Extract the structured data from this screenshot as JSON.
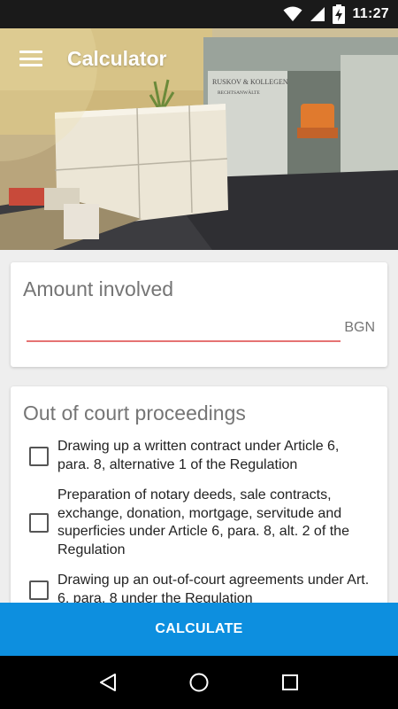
{
  "status_bar": {
    "time": "11:27",
    "icons": [
      "wifi-icon",
      "signal-icon",
      "battery-charging-icon"
    ]
  },
  "toolbar": {
    "title": "Calculator",
    "menu_icon": "hamburger-menu-icon"
  },
  "hero": {
    "sign_line1": "RUSKOV & KOLLEGEN",
    "sign_line2": "RECHTSANWÄLTE"
  },
  "amount": {
    "label": "Amount involved",
    "value": "",
    "currency": "BGN"
  },
  "proceedings": {
    "title": "Out of court proceedings",
    "options": [
      {
        "label": "Drawing up a written contract under Article 6, para. 8, alternative 1 of the Regulation",
        "checked": false
      },
      {
        "label": "Preparation of notary deeds, sale contracts, exchange, donation, mortgage, servitude and superficies under Article 6, para. 8, alt. 2 of the Regulation",
        "checked": false
      },
      {
        "label": "Drawing up an out-of-court agreements under Art. 6, para. 8 under the Regulation",
        "checked": false
      }
    ]
  },
  "actions": {
    "calculate_label": "CALCULATE"
  },
  "colors": {
    "accent": "#0d8fdf",
    "input_underline": "#e57373",
    "status_bar": "#1a1a1a"
  },
  "nav": {
    "back_icon": "back-triangle-icon",
    "home_icon": "home-circle-icon",
    "recents_icon": "recents-square-icon"
  }
}
